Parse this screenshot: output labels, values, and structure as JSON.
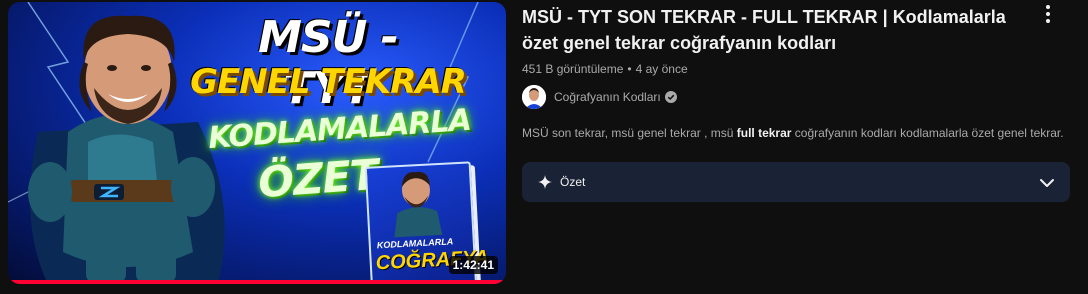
{
  "video": {
    "title": "MSÜ - TYT SON TEKRAR - FULL TEKRAR | Kodlamalarla özet genel tekrar coğrafyanın kodları",
    "views": "451 B görüntüleme",
    "age": "4 ay önce",
    "duration": "1:42:41",
    "progress_percent": 100
  },
  "thumbnail": {
    "line1": "MSÜ - TYT",
    "line2": "GENEL TEKRAR",
    "line3": "KODLAMALARLA",
    "line4": "ÖZET",
    "book_small": "KODLAMALARLA",
    "book_big": "COĞRAFYA"
  },
  "channel": {
    "name": "Coğrafyanın Kodları",
    "verified_icon": "verified-check-icon"
  },
  "description": {
    "before": "MSÜ son tekrar, msü genel tekrar , msü ",
    "bold": "full tekrar",
    "after": " coğrafyanın kodları kodlamalarla özet genel tekrar."
  },
  "summary": {
    "label": "Özet",
    "icon": "sparkle-icon",
    "expand_icon": "chevron-down-icon"
  },
  "actions": {
    "more_icon": "more-vert-icon"
  },
  "colors": {
    "background": "#0f0f0f",
    "progress": "#ff0033",
    "summary_bg": "#1a2236",
    "secondary_text": "#aaaaaa"
  }
}
